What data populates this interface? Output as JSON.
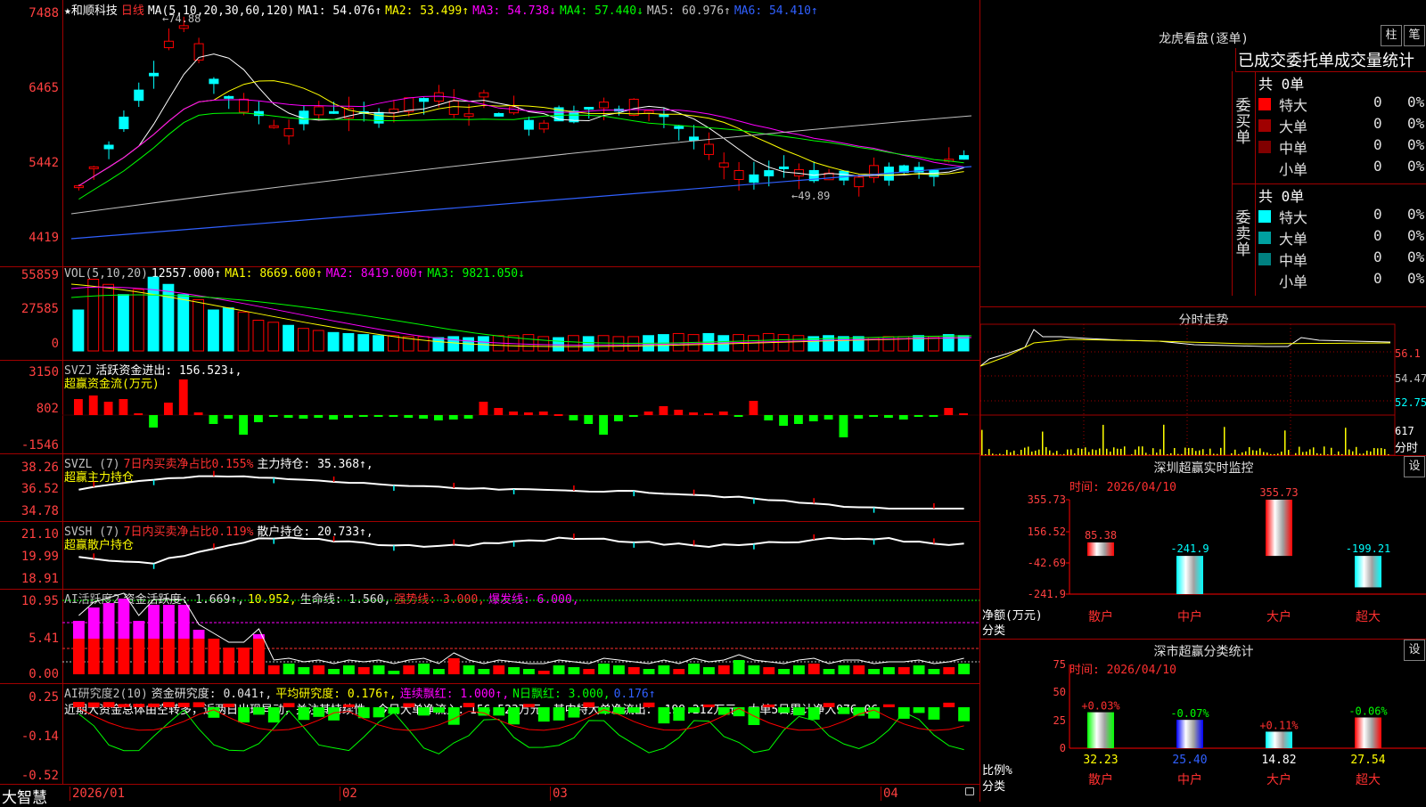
{
  "brand": "大智慧",
  "kline": {
    "star": "★",
    "stock": "和顺科技",
    "period": "日线",
    "ma_label": "MA(5,10,20,30,60,120)",
    "ma_values": [
      {
        "text": "MA1: 54.076↑",
        "color": "#ffffff"
      },
      {
        "text": "MA2: 53.499↑",
        "color": "#ffff00"
      },
      {
        "text": "MA3: 54.738↓",
        "color": "#ff00ff"
      },
      {
        "text": "MA4: 57.440↓",
        "color": "#00ff00"
      },
      {
        "text": "MA5: 60.976↑",
        "color": "#c0c0c0"
      },
      {
        "text": "MA6: 54.410↑",
        "color": "#3060ff"
      }
    ],
    "yticks": [
      "7488",
      "6465",
      "5442",
      "4419"
    ],
    "high_note": "74.88",
    "low_note": "49.89"
  },
  "vol": {
    "label": "VOL(5,10,20)",
    "value": "12557.000↑",
    "ma": [
      {
        "text": "MA1: 8669.600↑",
        "color": "#ffff00"
      },
      {
        "text": "MA2: 8419.000↑",
        "color": "#ff00ff"
      },
      {
        "text": "MA3: 9821.050↓",
        "color": "#00ff00"
      }
    ],
    "yticks": [
      "55859",
      "27585",
      "0"
    ]
  },
  "svzj": {
    "label": "SVZJ",
    "text": "活跃资金进出: 156.523↓,",
    "sub": "超赢资金流(万元)",
    "yticks": [
      "3150",
      "802",
      "-1546"
    ]
  },
  "svzl": {
    "label": "SVZL (7)",
    "red_text": "7日内买卖净占比0.155%",
    "text": "主力持仓: 35.368↑,",
    "sub": "超赢主力持仓",
    "yticks": [
      "38.26",
      "36.52",
      "34.78"
    ]
  },
  "svsh": {
    "label": "SVSH (7)",
    "red_text": "7日内买卖净占比0.119%",
    "text": "散户持仓: 20.733↑,",
    "sub": "超赢散户持仓",
    "yticks": [
      "21.10",
      "19.99",
      "18.91"
    ]
  },
  "ai1": {
    "label": "AI活跃度2",
    "parts": [
      {
        "text": "资金活跃度: 1.669↑,",
        "color": "#e0e0e0"
      },
      {
        "text": "10.952,",
        "color": "#ffff00"
      },
      {
        "text": "生命线: 1.560,",
        "color": "#e0e0e0"
      },
      {
        "text": "强势线: 3.000,",
        "color": "#ff3030"
      },
      {
        "text": "爆发线: 6.000,",
        "color": "#ff00ff"
      }
    ],
    "yticks": [
      "10.95",
      "5.41",
      "0.00"
    ]
  },
  "ai2": {
    "label": "AI研究度2(10)",
    "parts": [
      {
        "text": "资金研究度: 0.041↑,",
        "color": "#e0e0e0"
      },
      {
        "text": "平均研究度: 0.176↑,",
        "color": "#ffff00"
      },
      {
        "text": "连续飘红: 1.000↑,",
        "color": "#ff00ff"
      },
      {
        "text": "N日飘红: 3.000,",
        "color": "#00ff00"
      },
      {
        "text": "0.176↑",
        "color": "#3060ff"
      }
    ],
    "note": "近期大资金总体由空转多，近两日出现异动，关注其持续性，今日大单净流入：156.523万元，其中特大单净流出：-199.212万元，大单5日累计净入976.06",
    "yticks": [
      "0.25",
      "-0.14",
      "-0.52"
    ]
  },
  "xaxis": [
    "2026/01",
    "02",
    "03",
    "04"
  ],
  "dragon": {
    "title": "龙虎看盘(逐单)",
    "btn1": "柱",
    "btn2": "笔",
    "header": "已成交委托单成交量统计",
    "buy_label": "委买单",
    "sell_label": "委卖单",
    "buy_total": "共 0单",
    "sell_total": "共 0单",
    "buy_rows": [
      {
        "name": "特大",
        "count": "0",
        "pct": "0%",
        "color": "#ff0000"
      },
      {
        "name": "大单",
        "count": "0",
        "pct": "0%",
        "color": "#a00000"
      },
      {
        "name": "中单",
        "count": "0",
        "pct": "0%",
        "color": "#800000"
      },
      {
        "name": "小单",
        "count": "0",
        "pct": "0%",
        "color": "#000000"
      }
    ],
    "sell_rows": [
      {
        "name": "特大",
        "count": "0",
        "pct": "0%",
        "color": "#00ffff"
      },
      {
        "name": "大单",
        "count": "0",
        "pct": "0%",
        "color": "#00a0a0"
      },
      {
        "name": "中单",
        "count": "0",
        "pct": "0%",
        "color": "#008080"
      },
      {
        "name": "小单",
        "count": "0",
        "pct": "0%",
        "color": "#000000"
      }
    ]
  },
  "intraday": {
    "title": "分时走势",
    "yticks": [
      "56.1",
      "54.47",
      "52.75"
    ],
    "vol_tick": "617",
    "vol_label": "分时"
  },
  "monitor": {
    "title": "深圳超赢实时监控",
    "btn": "设",
    "date": "时间: 2026/04/10",
    "yticks": [
      "355.73",
      "156.52",
      "-42.69",
      "-241.9"
    ],
    "ylabel": "净额(万元)",
    "xlabel": "分类",
    "chart_data": {
      "type": "bar",
      "categories": [
        "散户",
        "中户",
        "大户",
        "超大"
      ],
      "values": [
        85.38,
        -241.9,
        355.73,
        -199.21
      ],
      "ylim": [
        -241.9,
        355.73
      ],
      "labels": [
        "85.38",
        "-241.9",
        "355.73",
        "-199.21"
      ]
    }
  },
  "classify": {
    "title": "深市超赢分类统计",
    "btn": "设",
    "date": "时间: 2026/04/10",
    "yticks": [
      "75",
      "50",
      "25",
      "0"
    ],
    "ylabel": "比例%",
    "xlabel": "分类",
    "chart_data": {
      "type": "bar",
      "categories": [
        "散户",
        "中户",
        "大户",
        "超大"
      ],
      "values": [
        32.23,
        25.4,
        14.82,
        27.54
      ],
      "changes": [
        "+0.03%",
        "-0.07%",
        "+0.11%",
        "-0.06%"
      ],
      "ylim": [
        0,
        75
      ]
    }
  },
  "colors": {
    "up": "#ff0000",
    "down": "#00ffff",
    "frame": "#a00000"
  }
}
